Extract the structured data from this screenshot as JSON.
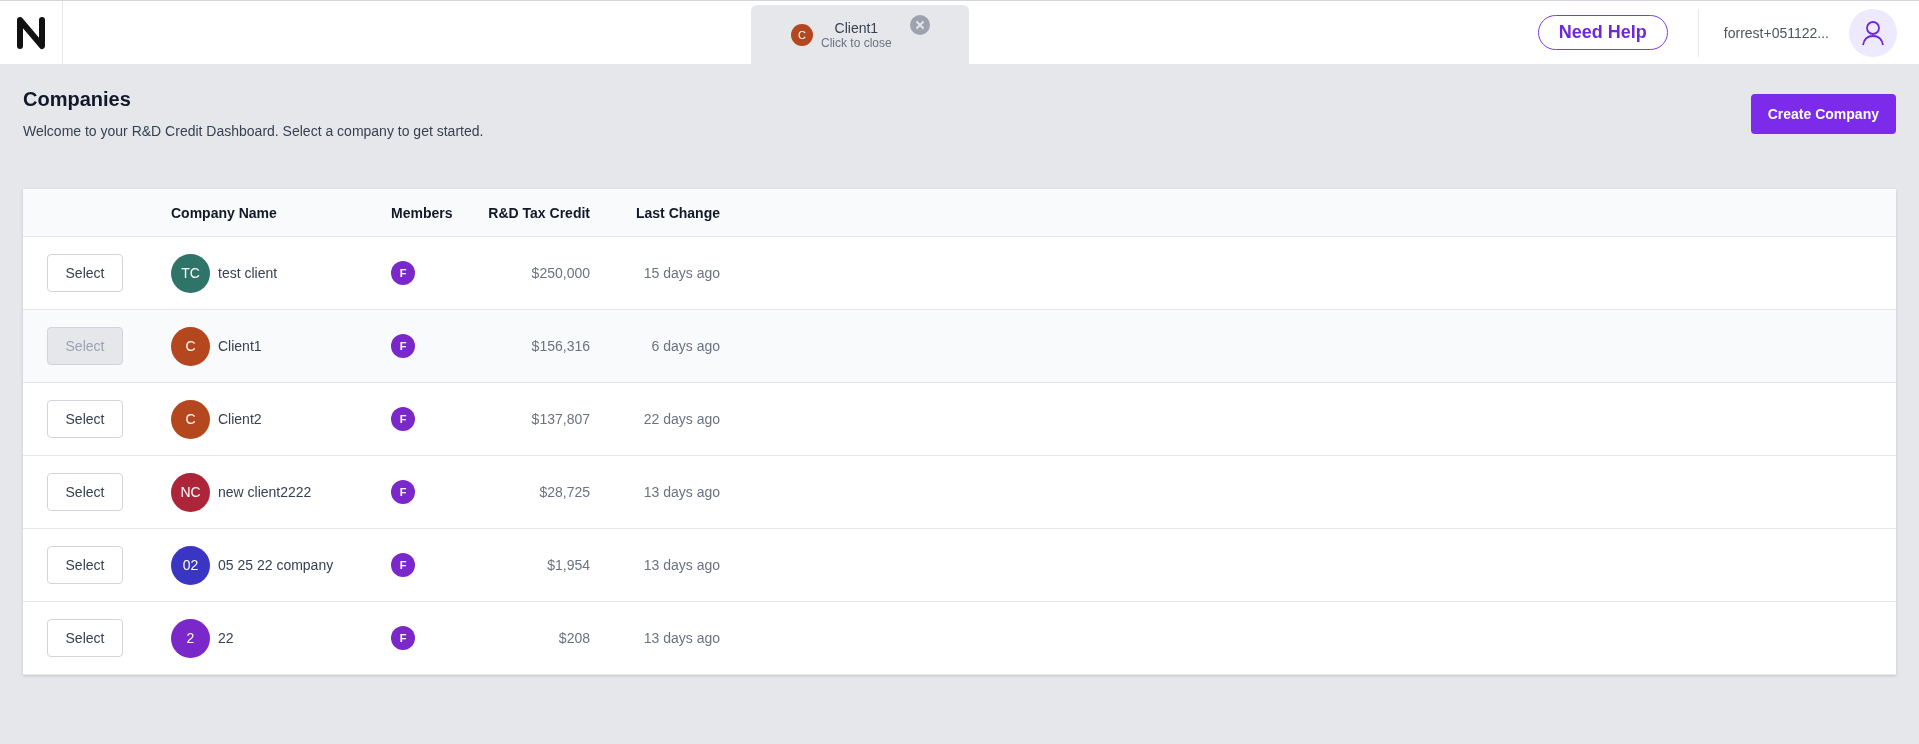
{
  "header": {
    "open_tab": {
      "initial": "C",
      "color": "#b5471f",
      "name": "Client1",
      "hint": "Click to close"
    },
    "help_button": "Need Help",
    "user": "forrest+051122..."
  },
  "page": {
    "title": "Companies",
    "subtitle": "Welcome to your R&D Credit Dashboard. Select a company to get started.",
    "create_button": "Create Company"
  },
  "table": {
    "columns": [
      "Company Name",
      "Members",
      "R&D Tax Credit",
      "Last Change"
    ],
    "rows": [
      {
        "button": "Select",
        "selected": false,
        "initials": "TC",
        "color": "#2f7468",
        "name": "test client",
        "members": [
          "F"
        ],
        "credit": "$250,000",
        "last_change": "15 days ago"
      },
      {
        "button": "Select",
        "selected": true,
        "initials": "C",
        "color": "#b5471f",
        "name": "Client1",
        "members": [
          "F"
        ],
        "credit": "$156,316",
        "last_change": "6 days ago"
      },
      {
        "button": "Select",
        "selected": false,
        "initials": "C",
        "color": "#b5471f",
        "name": "Client2",
        "members": [
          "F"
        ],
        "credit": "$137,807",
        "last_change": "22 days ago"
      },
      {
        "button": "Select",
        "selected": false,
        "initials": "NC",
        "color": "#ad2538",
        "name": "new client2222",
        "members": [
          "F"
        ],
        "credit": "$28,725",
        "last_change": "13 days ago"
      },
      {
        "button": "Select",
        "selected": false,
        "initials": "02",
        "color": "#3a35c2",
        "name": "05 25 22 company",
        "members": [
          "F"
        ],
        "credit": "$1,954",
        "last_change": "13 days ago"
      },
      {
        "button": "Select",
        "selected": false,
        "initials": "2",
        "color": "#7a28c9",
        "name": "22",
        "members": [
          "F"
        ],
        "credit": "$208",
        "last_change": "13 days ago"
      }
    ]
  }
}
